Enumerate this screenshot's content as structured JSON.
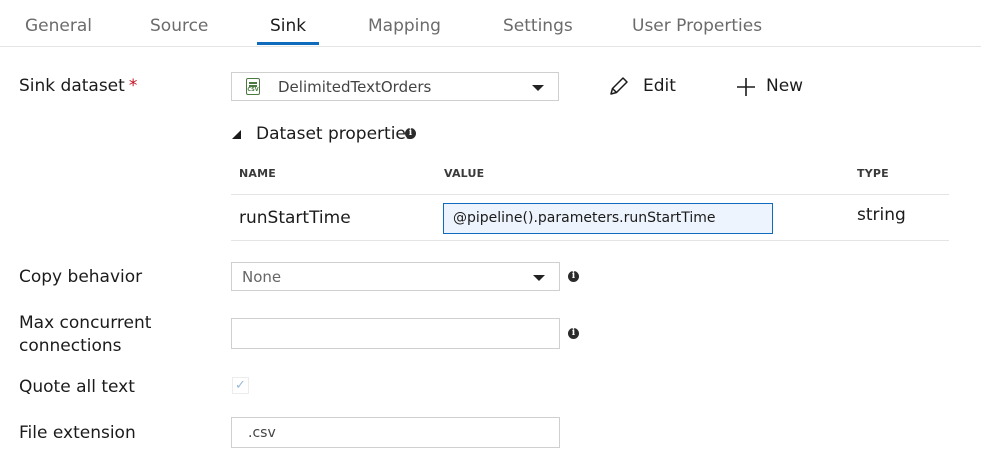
{
  "tabs": [
    {
      "label": "General",
      "active": false
    },
    {
      "label": "Source",
      "active": false
    },
    {
      "label": "Sink",
      "active": true
    },
    {
      "label": "Mapping",
      "active": false
    },
    {
      "label": "Settings",
      "active": false
    },
    {
      "label": "User Properties",
      "active": false
    }
  ],
  "sink": {
    "dataset_label": "Sink dataset",
    "required_marker": "*",
    "dataset_value": "DelimitedTextOrders",
    "dataset_icon": "csv-file-icon",
    "edit_label": "Edit",
    "new_label": "New",
    "dataset_properties_label": "Dataset properties",
    "table": {
      "columns": [
        "NAME",
        "VALUE",
        "TYPE"
      ],
      "rows": [
        {
          "name": "runStartTime",
          "value": "@pipeline().parameters.runStartTime",
          "type": "string"
        }
      ]
    },
    "copy_behavior_label": "Copy behavior",
    "copy_behavior_value": "None",
    "max_connections_label_line1": "Max concurrent",
    "max_connections_label_line2": "connections",
    "max_connections_value": "",
    "quote_all_text_label": "Quote all text",
    "quote_all_text_checked": true,
    "file_extension_label": "File extension",
    "file_extension_value": ".csv"
  },
  "colors": {
    "accent": "#0f6cbd",
    "required": "#c50f1f",
    "value_bg": "#eef4fd"
  }
}
